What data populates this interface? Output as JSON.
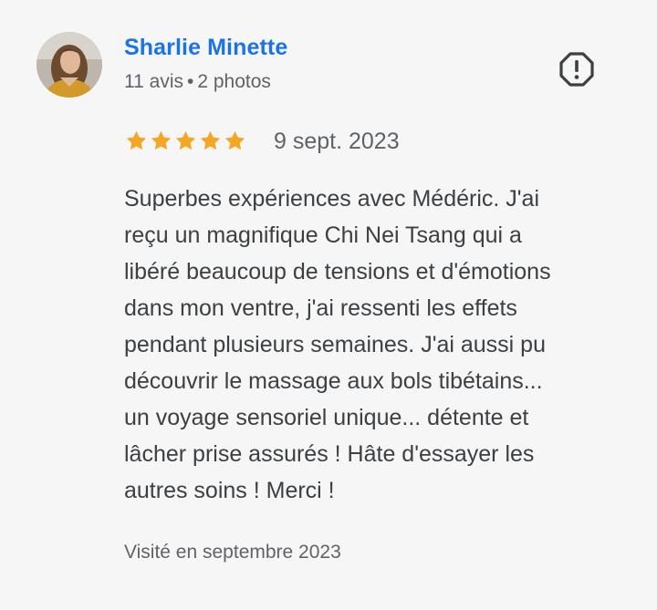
{
  "review": {
    "author": {
      "name": "Sharlie Minette",
      "reviews_count": "11 avis",
      "separator": "•",
      "photos_count": "2 photos"
    },
    "rating": 5,
    "rating_max": 5,
    "star_color": "#f5a623",
    "date": "9 sept. 2023",
    "text": "Superbes expériences avec Médéric. J'ai\nreçu un magnifique Chi Nei Tsang qui a\nlibéré beaucoup de tensions et d'émotions\ndans mon ventre, j'ai ressenti les effets\npendant plusieurs semaines. J'ai aussi pu\ndécouvrir le massage aux bols tibétains...\nun voyage sensoriel unique... détente et\nlâcher prise assurés ! Hâte d'essayer les\nautres soins ! Merci !",
    "visited": "Visité en septembre 2023",
    "flag_icon": "report-flag-icon"
  },
  "colors": {
    "name_link": "#1a73e8",
    "secondary_text": "#5f6368",
    "body_text": "#3c4043",
    "background": "#f6f6f7"
  }
}
